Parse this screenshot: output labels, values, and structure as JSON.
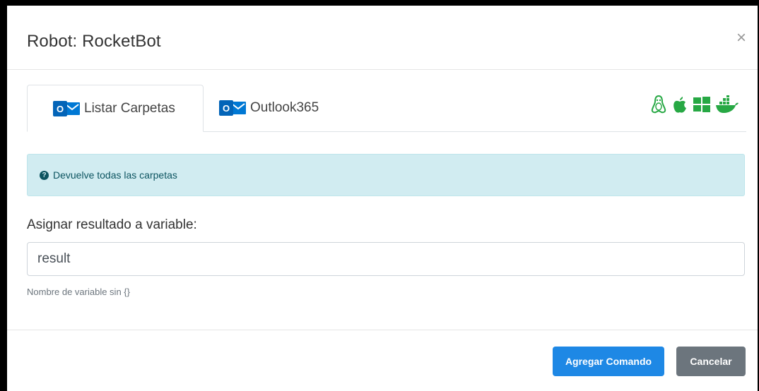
{
  "modal": {
    "title": "Robot: RocketBot",
    "close_label": "×"
  },
  "tabs": [
    {
      "label": "Listar Carpetas",
      "icon": "outlook-icon",
      "active": true
    },
    {
      "label": "Outlook365",
      "icon": "outlook-icon",
      "active": false
    }
  ],
  "os_icons": {
    "color": "#27a844",
    "items": [
      "linux-icon",
      "apple-icon",
      "windows-icon",
      "docker-icon"
    ]
  },
  "alert": {
    "text": "Devuelve todas las carpetas",
    "icon": "question-circle-icon",
    "background": "#d1ecf1"
  },
  "form": {
    "label": "Asignar resultado a variable:",
    "value": "result",
    "help": "Nombre de variable sin {}"
  },
  "footer": {
    "primary_label": "Agregar Comando",
    "secondary_label": "Cancelar",
    "primary_color": "#1e88e5",
    "secondary_color": "#6c757d"
  }
}
